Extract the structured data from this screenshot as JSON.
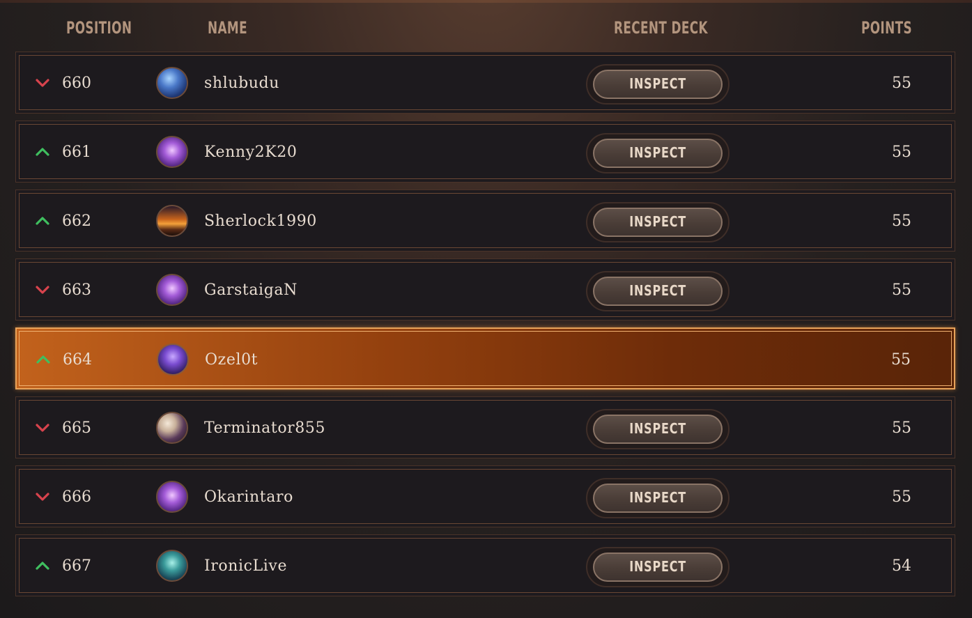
{
  "header": {
    "position": "POSITION",
    "name": "NAME",
    "recent_deck": "RECENT DECK",
    "points": "POINTS"
  },
  "colors": {
    "trend_up": "#3fbf5f",
    "trend_down": "#d8434d",
    "highlight": "#b8561a"
  },
  "rows": [
    {
      "position": "660",
      "trend": "down",
      "name": "shlubudu",
      "inspect": "INSPECT",
      "points": "55",
      "avatar": "blue-mage-avatar"
    },
    {
      "position": "661",
      "trend": "up",
      "name": "Kenny2K20",
      "inspect": "INSPECT",
      "points": "55",
      "avatar": "purple-crest-avatar"
    },
    {
      "position": "662",
      "trend": "up",
      "name": "Sherlock1990",
      "inspect": "INSPECT",
      "points": "55",
      "avatar": "sunset-warrior-avatar"
    },
    {
      "position": "663",
      "trend": "down",
      "name": "GarstaigaN",
      "inspect": "INSPECT",
      "points": "55",
      "avatar": "purple-crest-avatar"
    },
    {
      "position": "664",
      "trend": "up",
      "name": "Ozel0t",
      "inspect": "",
      "points": "55",
      "avatar": "violet-knight-avatar",
      "highlighted": true
    },
    {
      "position": "665",
      "trend": "down",
      "name": "Terminator855",
      "inspect": "INSPECT",
      "points": "55",
      "avatar": "hat-rider-avatar"
    },
    {
      "position": "666",
      "trend": "down",
      "name": "Okarintaro",
      "inspect": "INSPECT",
      "points": "55",
      "avatar": "purple-crest-avatar"
    },
    {
      "position": "667",
      "trend": "up",
      "name": "IronicLive",
      "inspect": "INSPECT",
      "points": "54",
      "avatar": "teal-hooded-avatar"
    }
  ]
}
